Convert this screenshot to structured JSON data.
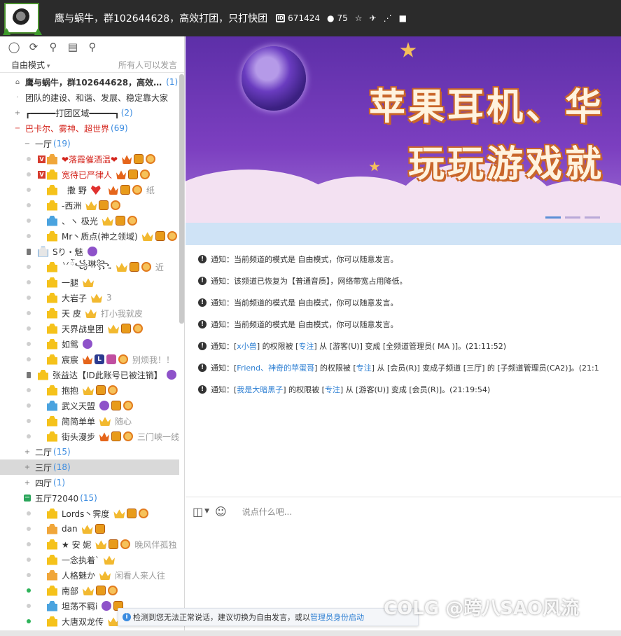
{
  "header": {
    "title": "鹰与蜗牛，群102644628，高效打团，只打快团",
    "room_id": "671424",
    "online_count": "75"
  },
  "sidebar": {
    "mode": "自由模式",
    "permission": "所有人可以发言"
  },
  "channels": [
    {
      "type": "root",
      "label": "鹰与蜗牛，群102644628，高效…",
      "count": "(1)"
    },
    {
      "type": "plain",
      "label": "团队的建设、和谐、发展、稳定靠大家"
    },
    {
      "type": "plus",
      "label": "┏━━━━━打团区域━━━━━┓",
      "count": "(2)"
    },
    {
      "type": "minus-red",
      "label": "巴卡尔、雾神、超世界",
      "count": "(69)"
    },
    {
      "type": "sub-minus",
      "label": "一厅",
      "count": "(19)"
    }
  ],
  "hall1_users": [
    {
      "name": "❤落霞催酒温❤",
      "red": true,
      "vip": true,
      "sig": ""
    },
    {
      "name": "宽待已严律人",
      "red": true,
      "vip": true,
      "sig": ""
    },
    {
      "name": "撒 野",
      "red": false,
      "sig": "纸"
    },
    {
      "name": "-西洲",
      "sig": ""
    },
    {
      "name": "、ヽ 极光",
      "sig": ""
    },
    {
      "name": "Mr丶质点(神之领域)",
      "sig": ""
    },
    {
      "name": "Sり・魅",
      "sig": ""
    },
    {
      "name": "丷ོ꧁琳꧂ ͈",
      "sig": "近"
    },
    {
      "name": "一腿",
      "sig": ""
    },
    {
      "name": "大岩子",
      "sig": "3"
    },
    {
      "name": "天 皮",
      "sig": "打小我就皮"
    },
    {
      "name": "天界战皇团",
      "sig": ""
    },
    {
      "name": "如鸳",
      "sig": ""
    },
    {
      "name": "宸宸",
      "sig": "别烦我！！"
    },
    {
      "name": "张益达【ID此账号已被注销】",
      "sig": ""
    },
    {
      "name": "抱抱",
      "sig": ""
    },
    {
      "name": "武义天盟",
      "sig": ""
    },
    {
      "name": "简简单单",
      "sig": "随心"
    },
    {
      "name": "街头漫步",
      "sig": "三门峡一线"
    }
  ],
  "halls": [
    {
      "label": "二厅",
      "count": "(15)"
    },
    {
      "label": "三厅",
      "count": "(18)"
    },
    {
      "label": "四厅",
      "count": "(1)"
    },
    {
      "label": "五厅72040",
      "count": "(15)"
    }
  ],
  "hall5_users": [
    {
      "name": "Lords丶霁度",
      "sig": ""
    },
    {
      "name": "dan",
      "sig": ""
    },
    {
      "name": "★ 安 妮",
      "sig": "晚风伴孤独"
    },
    {
      "name": "一念执着`",
      "sig": ""
    },
    {
      "name": "人格魅か",
      "sig": "闲看人来人往"
    },
    {
      "name": "南部",
      "sig": ""
    },
    {
      "name": "坦荡不羁i",
      "sig": ""
    },
    {
      "name": "大唐双龙传",
      "sig": ""
    }
  ],
  "banner": {
    "line1": "苹果耳机、华",
    "line2": "玩玩游戏就"
  },
  "messages": [
    {
      "prefix": "通知：",
      "text": "当前频道的模式是 自由模式，你可以随意发言。"
    },
    {
      "prefix": "通知：",
      "text": "该频道已恢复为【普通音质】，网络带宽占用降低。"
    },
    {
      "prefix": "通知：",
      "text": "当前频道的模式是 自由模式，你可以随意发言。"
    },
    {
      "prefix": "通知：",
      "text": "当前频道的模式是 自由模式，你可以随意发言。"
    },
    {
      "prefix": "通知：[",
      "link1": "x小兽",
      "mid1": "] 的权限被 [",
      "link2": "专注",
      "tail": "] 从 [游客(U)] 变成 [全频道管理员( MA )]。(21:11:52)"
    },
    {
      "prefix": "通知：[",
      "link1": "Friend、神奇的苹蛋哥",
      "mid1": "] 的权限被 [",
      "link2": "专注",
      "tail": "] 从 [会员(R)] 变成子频道 [三厅] 的 [子频道管理员(CA2)]。(21:1"
    },
    {
      "prefix": "通知：[",
      "link1": "我是大暗黑子",
      "mid1": "] 的权限被 [",
      "link2": "专注",
      "tail": "] 从 [游客(U)] 变成 [会员(R)]。(21:19:54)"
    }
  ],
  "input": {
    "placeholder": "说点什么吧..."
  },
  "notice": {
    "text": "检测到您无法正常说话，建议切换为自由发言，或以",
    "link": "管理员身份启动"
  },
  "watermark": "COLG @跨八SAO风流",
  "colors": {
    "topbar": "#2b2b2b",
    "accent_blue": "#3a8be0",
    "red_text": "#d4241c",
    "banner_purple": "#7c3fc0"
  }
}
